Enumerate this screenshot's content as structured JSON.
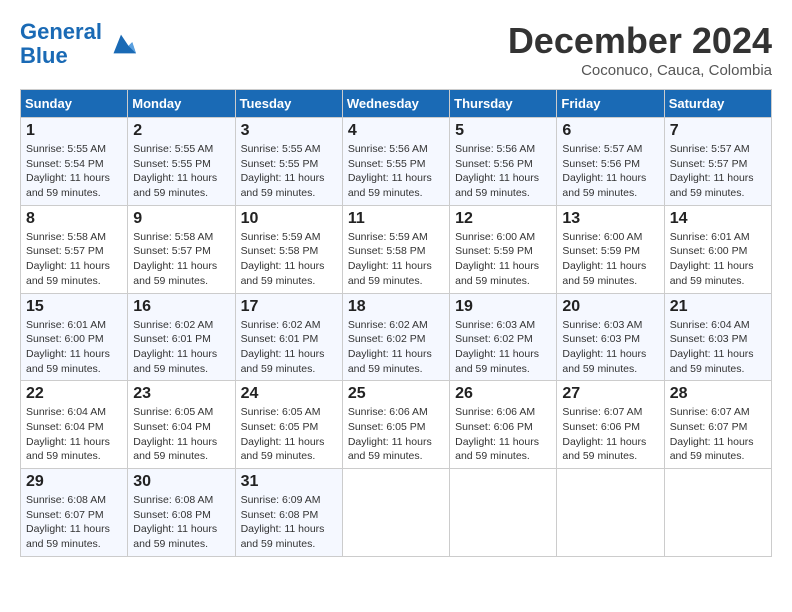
{
  "logo": {
    "line1": "General",
    "line2": "Blue"
  },
  "title": "December 2024",
  "location": "Coconuco, Cauca, Colombia",
  "days_header": [
    "Sunday",
    "Monday",
    "Tuesday",
    "Wednesday",
    "Thursday",
    "Friday",
    "Saturday"
  ],
  "weeks": [
    [
      {
        "day": "1",
        "sunrise": "5:55 AM",
        "sunset": "5:54 PM",
        "daylight": "11 hours and 59 minutes."
      },
      {
        "day": "2",
        "sunrise": "5:55 AM",
        "sunset": "5:55 PM",
        "daylight": "11 hours and 59 minutes."
      },
      {
        "day": "3",
        "sunrise": "5:55 AM",
        "sunset": "5:55 PM",
        "daylight": "11 hours and 59 minutes."
      },
      {
        "day": "4",
        "sunrise": "5:56 AM",
        "sunset": "5:55 PM",
        "daylight": "11 hours and 59 minutes."
      },
      {
        "day": "5",
        "sunrise": "5:56 AM",
        "sunset": "5:56 PM",
        "daylight": "11 hours and 59 minutes."
      },
      {
        "day": "6",
        "sunrise": "5:57 AM",
        "sunset": "5:56 PM",
        "daylight": "11 hours and 59 minutes."
      },
      {
        "day": "7",
        "sunrise": "5:57 AM",
        "sunset": "5:57 PM",
        "daylight": "11 hours and 59 minutes."
      }
    ],
    [
      {
        "day": "8",
        "sunrise": "5:58 AM",
        "sunset": "5:57 PM",
        "daylight": "11 hours and 59 minutes."
      },
      {
        "day": "9",
        "sunrise": "5:58 AM",
        "sunset": "5:57 PM",
        "daylight": "11 hours and 59 minutes."
      },
      {
        "day": "10",
        "sunrise": "5:59 AM",
        "sunset": "5:58 PM",
        "daylight": "11 hours and 59 minutes."
      },
      {
        "day": "11",
        "sunrise": "5:59 AM",
        "sunset": "5:58 PM",
        "daylight": "11 hours and 59 minutes."
      },
      {
        "day": "12",
        "sunrise": "6:00 AM",
        "sunset": "5:59 PM",
        "daylight": "11 hours and 59 minutes."
      },
      {
        "day": "13",
        "sunrise": "6:00 AM",
        "sunset": "5:59 PM",
        "daylight": "11 hours and 59 minutes."
      },
      {
        "day": "14",
        "sunrise": "6:01 AM",
        "sunset": "6:00 PM",
        "daylight": "11 hours and 59 minutes."
      }
    ],
    [
      {
        "day": "15",
        "sunrise": "6:01 AM",
        "sunset": "6:00 PM",
        "daylight": "11 hours and 59 minutes."
      },
      {
        "day": "16",
        "sunrise": "6:02 AM",
        "sunset": "6:01 PM",
        "daylight": "11 hours and 59 minutes."
      },
      {
        "day": "17",
        "sunrise": "6:02 AM",
        "sunset": "6:01 PM",
        "daylight": "11 hours and 59 minutes."
      },
      {
        "day": "18",
        "sunrise": "6:02 AM",
        "sunset": "6:02 PM",
        "daylight": "11 hours and 59 minutes."
      },
      {
        "day": "19",
        "sunrise": "6:03 AM",
        "sunset": "6:02 PM",
        "daylight": "11 hours and 59 minutes."
      },
      {
        "day": "20",
        "sunrise": "6:03 AM",
        "sunset": "6:03 PM",
        "daylight": "11 hours and 59 minutes."
      },
      {
        "day": "21",
        "sunrise": "6:04 AM",
        "sunset": "6:03 PM",
        "daylight": "11 hours and 59 minutes."
      }
    ],
    [
      {
        "day": "22",
        "sunrise": "6:04 AM",
        "sunset": "6:04 PM",
        "daylight": "11 hours and 59 minutes."
      },
      {
        "day": "23",
        "sunrise": "6:05 AM",
        "sunset": "6:04 PM",
        "daylight": "11 hours and 59 minutes."
      },
      {
        "day": "24",
        "sunrise": "6:05 AM",
        "sunset": "6:05 PM",
        "daylight": "11 hours and 59 minutes."
      },
      {
        "day": "25",
        "sunrise": "6:06 AM",
        "sunset": "6:05 PM",
        "daylight": "11 hours and 59 minutes."
      },
      {
        "day": "26",
        "sunrise": "6:06 AM",
        "sunset": "6:06 PM",
        "daylight": "11 hours and 59 minutes."
      },
      {
        "day": "27",
        "sunrise": "6:07 AM",
        "sunset": "6:06 PM",
        "daylight": "11 hours and 59 minutes."
      },
      {
        "day": "28",
        "sunrise": "6:07 AM",
        "sunset": "6:07 PM",
        "daylight": "11 hours and 59 minutes."
      }
    ],
    [
      {
        "day": "29",
        "sunrise": "6:08 AM",
        "sunset": "6:07 PM",
        "daylight": "11 hours and 59 minutes."
      },
      {
        "day": "30",
        "sunrise": "6:08 AM",
        "sunset": "6:08 PM",
        "daylight": "11 hours and 59 minutes."
      },
      {
        "day": "31",
        "sunrise": "6:09 AM",
        "sunset": "6:08 PM",
        "daylight": "11 hours and 59 minutes."
      },
      null,
      null,
      null,
      null
    ]
  ]
}
